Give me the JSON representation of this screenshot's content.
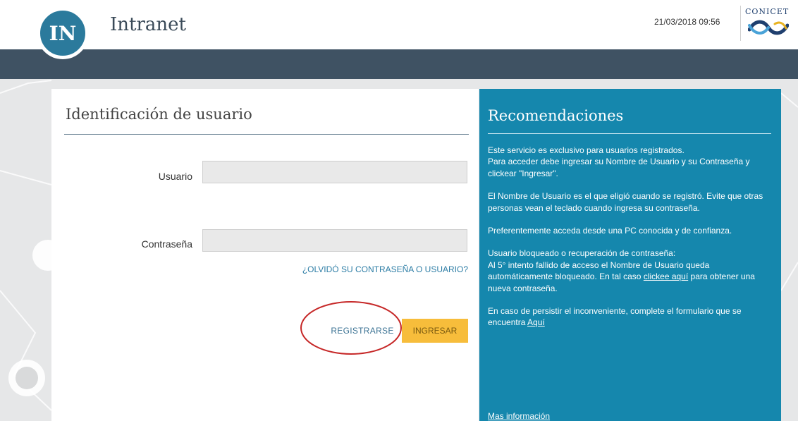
{
  "header": {
    "logo_text": "IN",
    "app_title": "Intranet",
    "datetime": "21/03/2018 09:56",
    "org_name": "CONICET"
  },
  "login": {
    "title": "Identificación de usuario",
    "username_label": "Usuario",
    "username_value": "",
    "password_label": "Contraseña",
    "password_value": "",
    "forgot_link": "¿OLVIDÓ SU CONTRASEÑA O USUARIO?",
    "register_button": "REGISTRARSE",
    "login_button": "INGRESAR"
  },
  "recommendations": {
    "title": "Recomendaciones",
    "p1_line1": "Este servicio es exclusivo para usuarios registrados.",
    "p1_line2": "Para acceder debe ingresar su Nombre de Usuario y su Contraseña y clickear \"Ingresar\".",
    "p2": "El Nombre de Usuario es el que eligió cuando se registró. Evite que otras personas vean el teclado cuando ingresa su contraseña.",
    "p3": "Preferentemente acceda desde una PC conocida y de confianza.",
    "p4_line1": "Usuario bloqueado o recuperación de contraseña:",
    "p4_text": "Al 5° intento fallido de acceso el Nombre de Usuario queda automáticamente bloqueado. En tal caso ",
    "p4_link": "clickee aquí",
    "p4_after": " para obtener una nueva contraseña.",
    "p5_text": "En caso de persistir el inconveniente, complete el formulario que se encuentra ",
    "p5_link": "Aquí",
    "more_info": "Mas información"
  },
  "colors": {
    "navbar": "#3f5263",
    "panel": "#1587ad",
    "login_button": "#f7bd3b",
    "annotation": "#c62828"
  }
}
